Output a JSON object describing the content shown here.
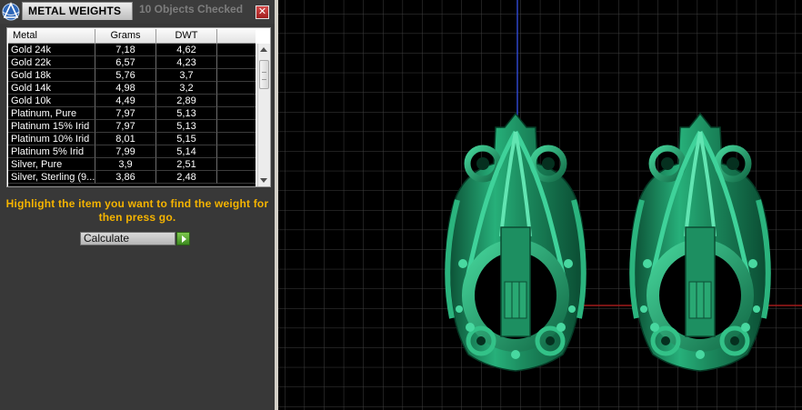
{
  "window": {
    "title": "METAL WEIGHTS",
    "objects_checked": "10 Objects Checked",
    "close_icon": "close-icon",
    "logo_icon": "matrix-logo-icon"
  },
  "table": {
    "columns": [
      "Metal",
      "Grams",
      "DWT"
    ],
    "rows": [
      {
        "metal": "Gold 24k",
        "grams": "7,18",
        "dwt": "4,62"
      },
      {
        "metal": "Gold 22k",
        "grams": "6,57",
        "dwt": "4,23"
      },
      {
        "metal": "Gold 18k",
        "grams": "5,76",
        "dwt": "3,7"
      },
      {
        "metal": "Gold 14k",
        "grams": "4,98",
        "dwt": "3,2"
      },
      {
        "metal": "Gold 10k",
        "grams": "4,49",
        "dwt": "2,89"
      },
      {
        "metal": "Platinum, Pure",
        "grams": "7,97",
        "dwt": "5,13"
      },
      {
        "metal": "Platinum 15% Irid",
        "grams": "7,97",
        "dwt": "5,13"
      },
      {
        "metal": "Platinum 10% Irid",
        "grams": "8,01",
        "dwt": "5,15"
      },
      {
        "metal": "Platinum 5% Irid",
        "grams": "7,99",
        "dwt": "5,14"
      },
      {
        "metal": "Silver, Pure",
        "grams": "3,9",
        "dwt": "2,51"
      },
      {
        "metal": "Silver, Sterling (9...",
        "grams": "3,86",
        "dwt": "2,48"
      }
    ]
  },
  "instruction": {
    "line1": "Highlight the item you want to find the weight for",
    "line2": "then press go."
  },
  "calculate": {
    "selected": "Calculate",
    "go_icon": "play-arrow-icon"
  },
  "viewport": {
    "background": "#000000",
    "grid_color": "#3a3a3a",
    "axis_y_color": "#2d46c8",
    "axis_x_color": "#a11a1a",
    "model_color": "#1f8f63",
    "models": [
      "earring-left",
      "earring-right"
    ]
  }
}
